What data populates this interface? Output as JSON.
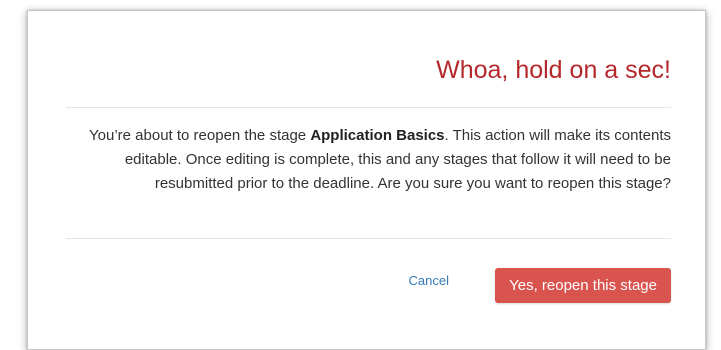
{
  "dialog": {
    "title": "Whoa, hold on a sec!",
    "message_before": "You’re about to reopen the stage ",
    "stage_name": "Application Basics",
    "message_after": ". This action will make its contents editable. Once editing is complete, this and any stages that follow it will need to be resubmitted prior to the deadline. Are you sure you want to reopen this stage?",
    "cancel_label": "Cancel",
    "confirm_label": "Yes, reopen this stage"
  },
  "colors": {
    "title": "#b5282b",
    "confirm_button": "#d9534f",
    "cancel_link": "#337ab7"
  }
}
